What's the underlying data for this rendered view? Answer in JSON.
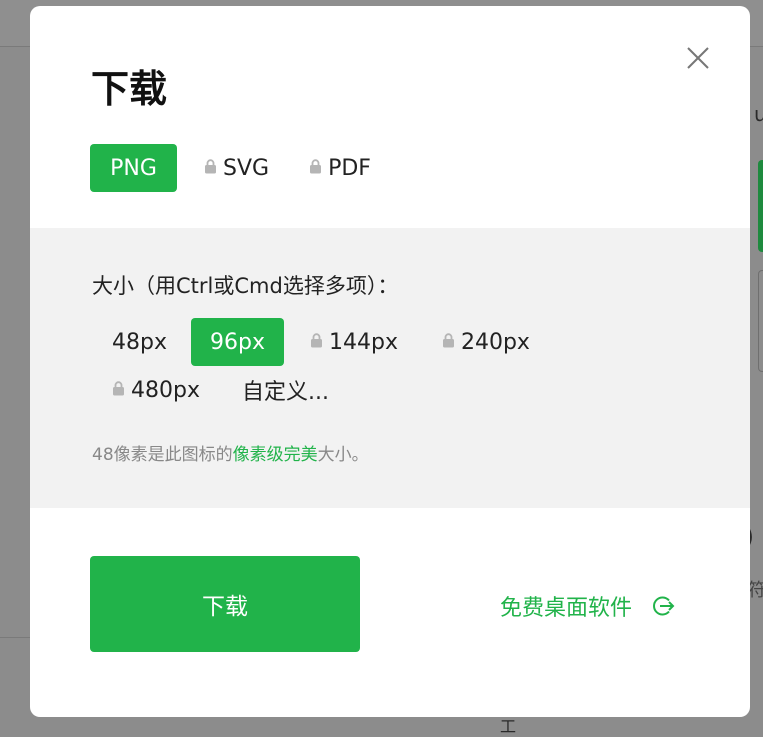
{
  "dialog": {
    "title": "下载",
    "formats": [
      {
        "label": "PNG",
        "locked": false,
        "active": true
      },
      {
        "label": "SVG",
        "locked": true,
        "active": false
      },
      {
        "label": "PDF",
        "locked": true,
        "active": false
      }
    ],
    "size_label": "大小（用Ctrl或Cmd选择多项）：",
    "sizes": [
      {
        "label": "48px",
        "locked": false,
        "active": false
      },
      {
        "label": "96px",
        "locked": false,
        "active": true
      },
      {
        "label": "144px",
        "locked": true,
        "active": false
      },
      {
        "label": "240px",
        "locked": true,
        "active": false
      },
      {
        "label": "480px",
        "locked": true,
        "active": false
      },
      {
        "label": "自定义...",
        "locked": false,
        "active": false
      }
    ],
    "hint_prefix": "48像素是此图标的",
    "hint_link": "像素级完美",
    "hint_suffix": "大小。",
    "download_label": "下载",
    "desktop_link_label": "免费桌面软件",
    "accent_color": "#21b34a"
  },
  "background": {
    "right_text_top": "u",
    "right_text_mid": ")",
    "right_text_low": "符",
    "bottom_glyph": "工"
  }
}
